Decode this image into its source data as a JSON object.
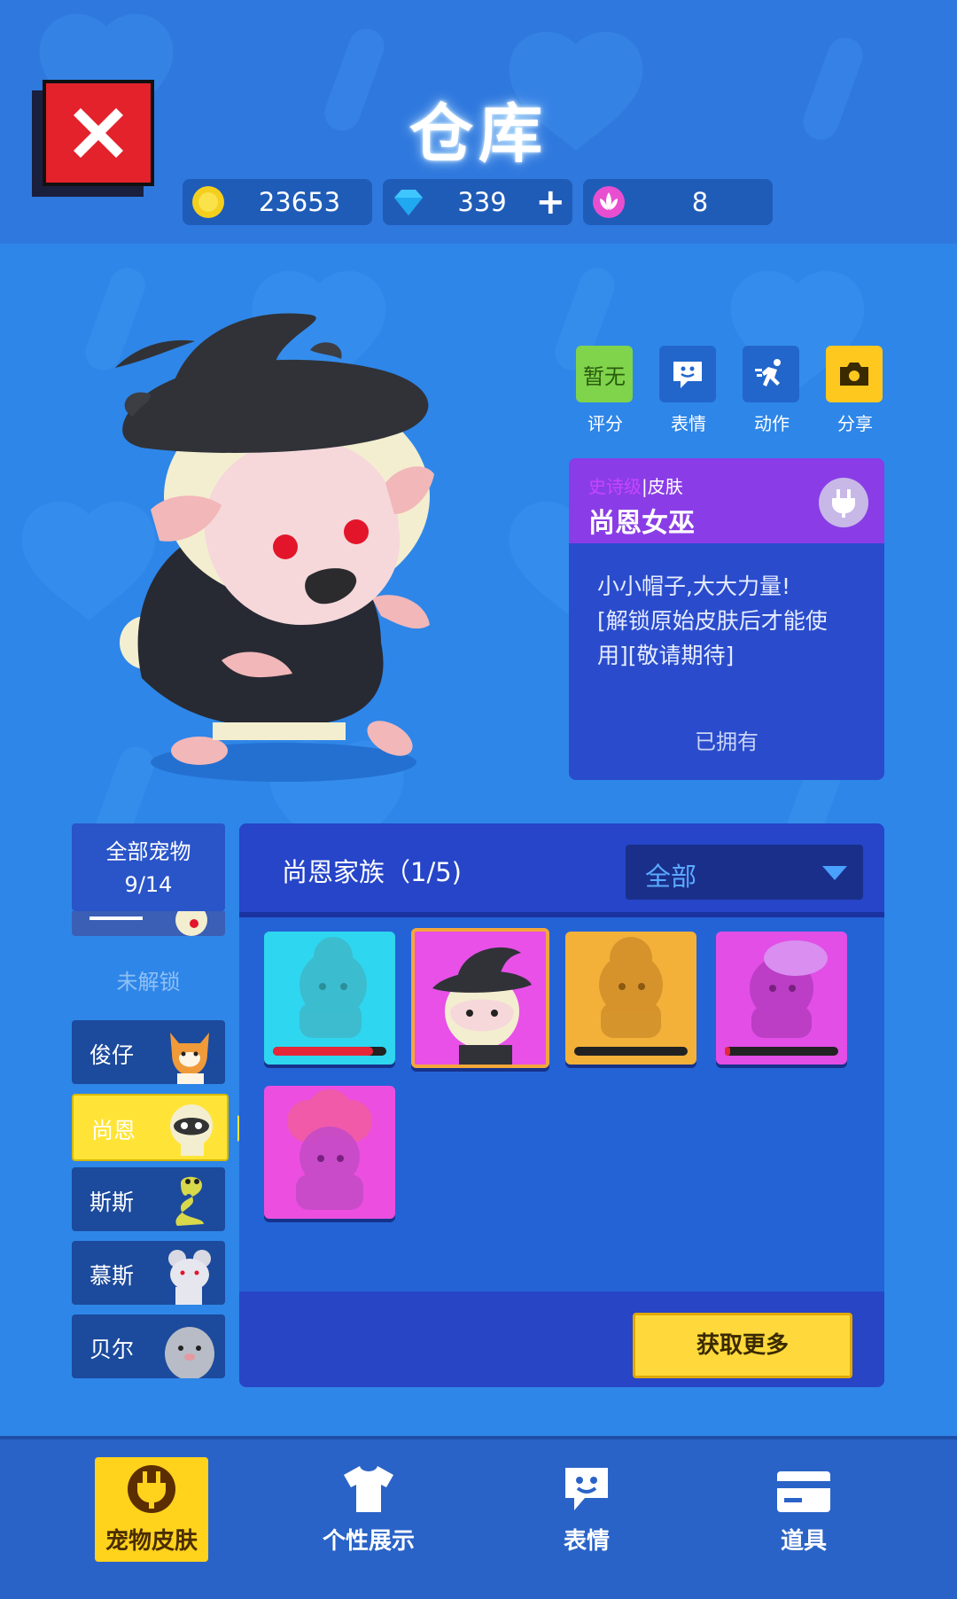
{
  "header": {
    "title": "仓库",
    "coins": "23653",
    "gems": "339",
    "tokens": "8"
  },
  "actions": [
    {
      "label": "评分",
      "box_text": "暂无",
      "color": "#7fd44b"
    },
    {
      "label": "表情",
      "color": "#2266cc"
    },
    {
      "label": "动作",
      "color": "#2266cc"
    },
    {
      "label": "分享",
      "color": "#ffc81e"
    }
  ],
  "skin_card": {
    "rarity": "史诗级",
    "type": "|皮肤",
    "name": "尚恩女巫",
    "description": "小小帽子,大大力量!\n[解锁原始皮肤后才能使用][敬请期待]",
    "desc_lines": [
      "小小帽子,大大力量!",
      "[解锁原始皮肤后才能使",
      "用][敬请期待]"
    ],
    "status": "已拥有"
  },
  "pet_list": {
    "all_title": "全部宠物",
    "all_count": "9/14",
    "locked_label": "未解锁",
    "pets": [
      {
        "name": "俊仔",
        "selected": false
      },
      {
        "name": "尚恩",
        "selected": true
      },
      {
        "name": "斯斯",
        "selected": false
      },
      {
        "name": "慕斯",
        "selected": false
      },
      {
        "name": "贝尔",
        "selected": false
      }
    ]
  },
  "skins_panel": {
    "family": "尚恩家族（1/5)",
    "filter": "全部",
    "skins": [
      {
        "color": "#2fd6ef",
        "progress": 0.88,
        "selected": false
      },
      {
        "color": "#e850e8",
        "progress": null,
        "selected": true
      },
      {
        "color": "#f3b13a",
        "progress": 0.0,
        "selected": false
      },
      {
        "color": "#e24ee6",
        "progress": 0.05,
        "selected": false
      },
      {
        "color": "#ec4fe0",
        "progress": null,
        "selected": false
      }
    ],
    "more_button": "获取更多"
  },
  "nav": {
    "items": [
      {
        "label": "宠物皮肤",
        "icon": "plug-icon",
        "active": true
      },
      {
        "label": "个性展示",
        "icon": "tshirt-icon",
        "active": false
      },
      {
        "label": "表情",
        "icon": "chat-smile-icon",
        "active": false
      },
      {
        "label": "道具",
        "icon": "card-icon",
        "active": false
      }
    ]
  }
}
